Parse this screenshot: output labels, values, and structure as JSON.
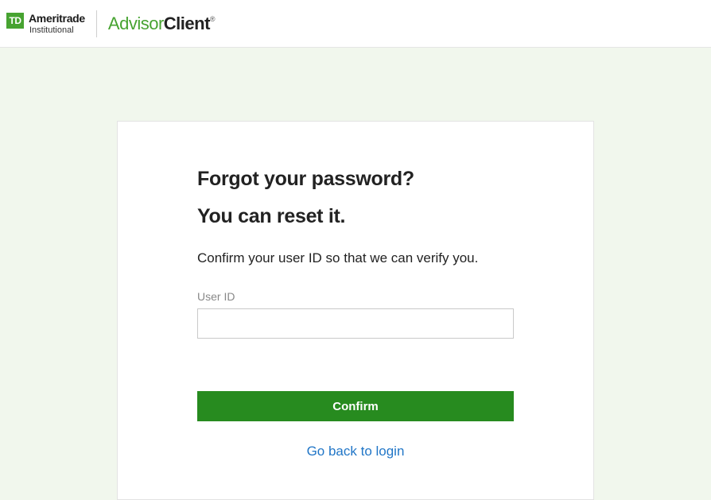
{
  "header": {
    "td_box": "TD",
    "ameritrade": "Ameritrade",
    "institutional": "Institutional",
    "advisor": "Advisor",
    "client": "Client",
    "reg": "®"
  },
  "card": {
    "heading1": "Forgot your password?",
    "heading2": "You can reset it.",
    "subtext": "Confirm your user ID so that we can verify you.",
    "user_id_label": "User ID",
    "confirm_label": "Confirm",
    "back_link": "Go back to login"
  }
}
